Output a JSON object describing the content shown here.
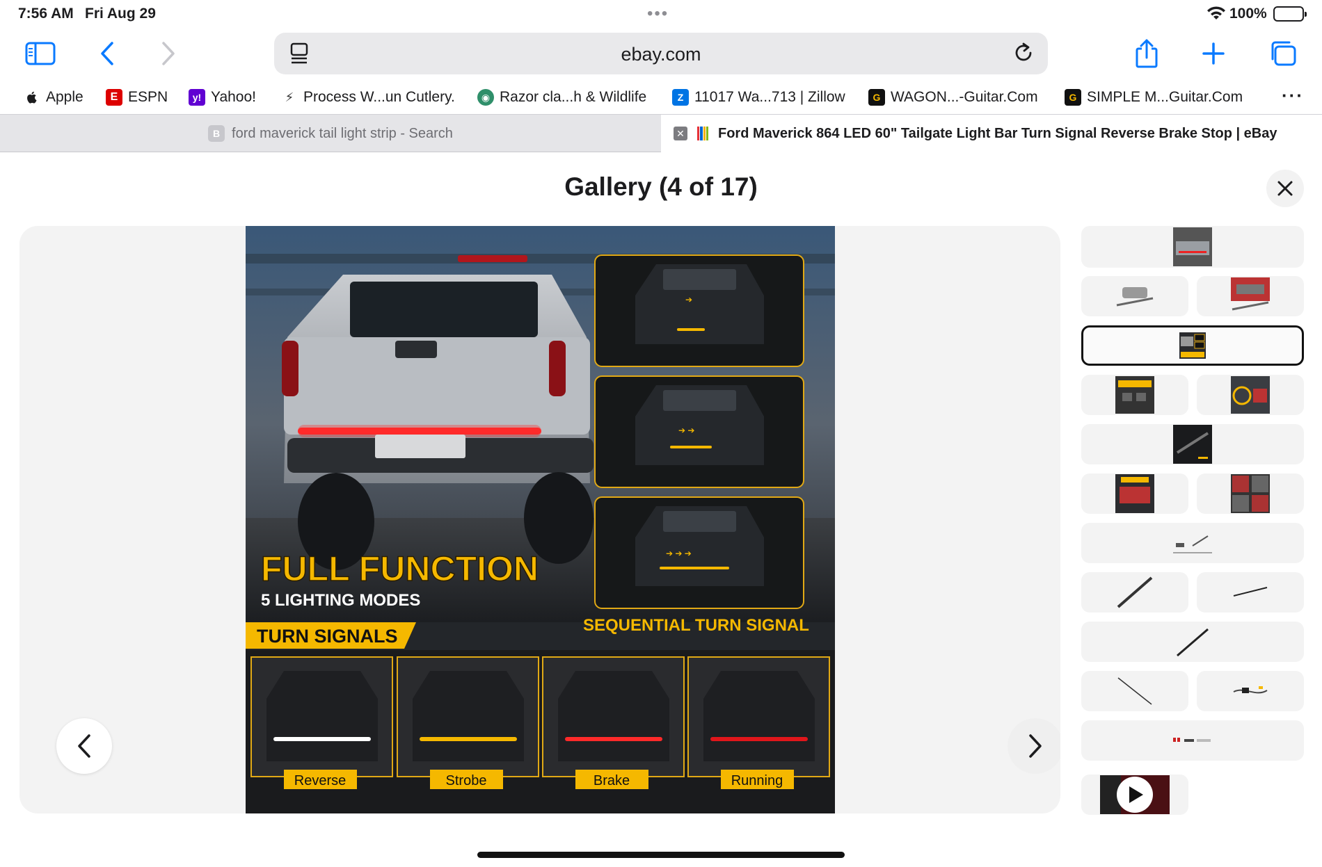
{
  "status_bar": {
    "time": "7:56 AM",
    "date": "Fri Aug 29",
    "battery": "100%"
  },
  "toolbar": {
    "url": "ebay.com",
    "icons": [
      "sidebar-icon",
      "back-chevron-icon",
      "forward-chevron-icon",
      "reader-icon",
      "reload-icon",
      "share-icon",
      "plus-icon",
      "tabs-icon"
    ]
  },
  "favorites": [
    {
      "label": "Apple",
      "icon": "apple-icon"
    },
    {
      "label": "ESPN",
      "icon": "espn-icon"
    },
    {
      "label": "Yahoo!",
      "icon": "yahoo-icon"
    },
    {
      "label": "Process W...un Cutlery.",
      "icon": "process-icon"
    },
    {
      "label": "Razor cla...h & Wildlife",
      "icon": "globe-icon"
    },
    {
      "label": "11017 Wa...713 | Zillow",
      "icon": "zillow-icon"
    },
    {
      "label": "WAGON...-Guitar.Com",
      "icon": "guitar-icon"
    },
    {
      "label": "SIMPLE M...Guitar.Com",
      "icon": "guitar-icon"
    }
  ],
  "tabs": [
    {
      "label": "ford maverick tail light strip - Search",
      "favicon": "B",
      "active": false
    },
    {
      "label": "Ford Maverick 864 LED 60\" Tailgate Light Bar Turn Signal Reverse Brake Stop | eBay",
      "active": true
    }
  ],
  "gallery": {
    "title": "Gallery (4 of 17)",
    "current": 4,
    "total": 17,
    "image": {
      "headline": "FULL FUNCTION",
      "subhead": "5 LIGHTING MODES",
      "turn_signals": "TURN SIGNALS",
      "sequential": "SEQUENTIAL TURN SIGNAL",
      "modes": [
        "Reverse",
        "Strobe",
        "Brake",
        "Running"
      ]
    },
    "thumbnails_count": 17,
    "selected_thumbnail": 4
  },
  "colors": {
    "accent_blue": "#0a7aff",
    "promo_yellow": "#f5b800",
    "brake_red": "#e0161b"
  }
}
